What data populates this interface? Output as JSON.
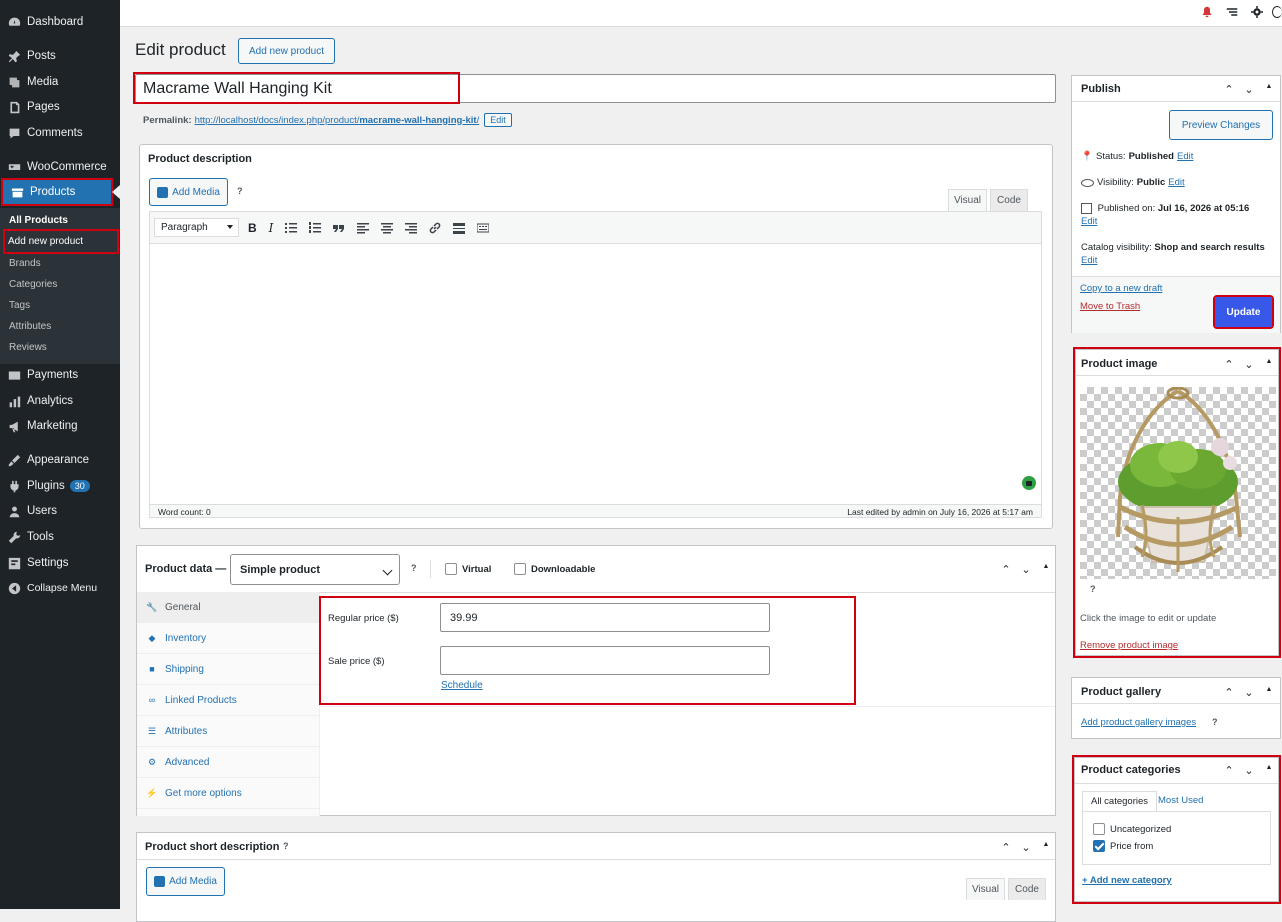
{
  "sidebar": {
    "items": [
      {
        "label": "Dashboard",
        "icon": "dashboard-icon"
      },
      {
        "label": "Posts",
        "icon": "pin-icon"
      },
      {
        "label": "Media",
        "icon": "media-icon"
      },
      {
        "label": "Pages",
        "icon": "pages-icon"
      },
      {
        "label": "Comments",
        "icon": "comments-icon"
      },
      {
        "label": "WooCommerce",
        "icon": "woocommerce-icon"
      },
      {
        "label": "Products",
        "icon": "products-icon"
      },
      {
        "label": "Payments",
        "icon": "payments-icon"
      },
      {
        "label": "Analytics",
        "icon": "analytics-icon"
      },
      {
        "label": "Marketing",
        "icon": "marketing-icon"
      },
      {
        "label": "Appearance",
        "icon": "appearance-icon"
      },
      {
        "label": "Plugins",
        "icon": "plugins-icon",
        "badge": "30"
      },
      {
        "label": "Users",
        "icon": "users-icon"
      },
      {
        "label": "Tools",
        "icon": "tools-icon"
      },
      {
        "label": "Settings",
        "icon": "settings-icon"
      },
      {
        "label": "Collapse Menu",
        "icon": "collapse-icon"
      }
    ],
    "products_submenu": [
      "All Products",
      "Add new product",
      "Brands",
      "Categories",
      "Tags",
      "Attributes",
      "Reviews"
    ]
  },
  "header": {
    "title": "Edit product",
    "add_new_label": "Add new product"
  },
  "product": {
    "title": "Macrame Wall Hanging Kit",
    "permalink_label": "Permalink:",
    "permalink_base": "http://localhost/docs/index.php/product/",
    "permalink_slug": "macrame-wall-hanging-kit",
    "permalink_trailing": "/",
    "permalink_edit": "Edit"
  },
  "description": {
    "heading": "Product description",
    "add_media": "Add Media",
    "help": "?",
    "tab_visual": "Visual",
    "tab_code": "Code",
    "format_select": "Paragraph",
    "word_count": "Word count: 0",
    "last_edited": "Last edited by admin on July 16, 2026 at 5:17 am"
  },
  "product_data": {
    "heading": "Product data —",
    "type": "Simple product",
    "help": "?",
    "virtual_label": "Virtual",
    "virtual_checked": false,
    "downloadable_label": "Downloadable",
    "downloadable_checked": false,
    "tabs": [
      "General",
      "Inventory",
      "Shipping",
      "Linked Products",
      "Attributes",
      "Advanced",
      "Get more options"
    ],
    "regular_price_label": "Regular price ($)",
    "regular_price": "39.99",
    "sale_price_label": "Sale price ($)",
    "sale_price": "",
    "schedule": "Schedule"
  },
  "short_description": {
    "heading": "Product short description",
    "help": "?",
    "add_media": "Add Media",
    "tab_visual": "Visual",
    "tab_code": "Code"
  },
  "publish": {
    "heading": "Publish",
    "preview": "Preview Changes",
    "status_label": "Status:",
    "status_value": "Published",
    "visibility_label": "Visibility:",
    "visibility_value": "Public",
    "published_label": "Published on:",
    "published_value": "Jul 16, 2026 at 05:16",
    "catalog_label": "Catalog visibility:",
    "catalog_value": "Shop and search results",
    "edit": "Edit",
    "copy_draft": "Copy to a new draft",
    "trash": "Move to Trash",
    "update": "Update"
  },
  "product_image": {
    "heading": "Product image",
    "help": "?",
    "hint": "Click the image to edit or update",
    "remove": "Remove product image"
  },
  "gallery": {
    "heading": "Product gallery",
    "add": "Add product gallery images",
    "help": "?"
  },
  "categories": {
    "heading": "Product categories",
    "tab_all": "All categories",
    "tab_most": "Most Used",
    "items": [
      {
        "label": "Uncategorized",
        "checked": false
      },
      {
        "label": "Price from",
        "checked": true
      }
    ],
    "add": "+ Add new category"
  },
  "colors": {
    "accent": "#2271b1",
    "sidebar": "#1d2327",
    "update_button": "#3858e9",
    "highlight": "#d00010"
  }
}
